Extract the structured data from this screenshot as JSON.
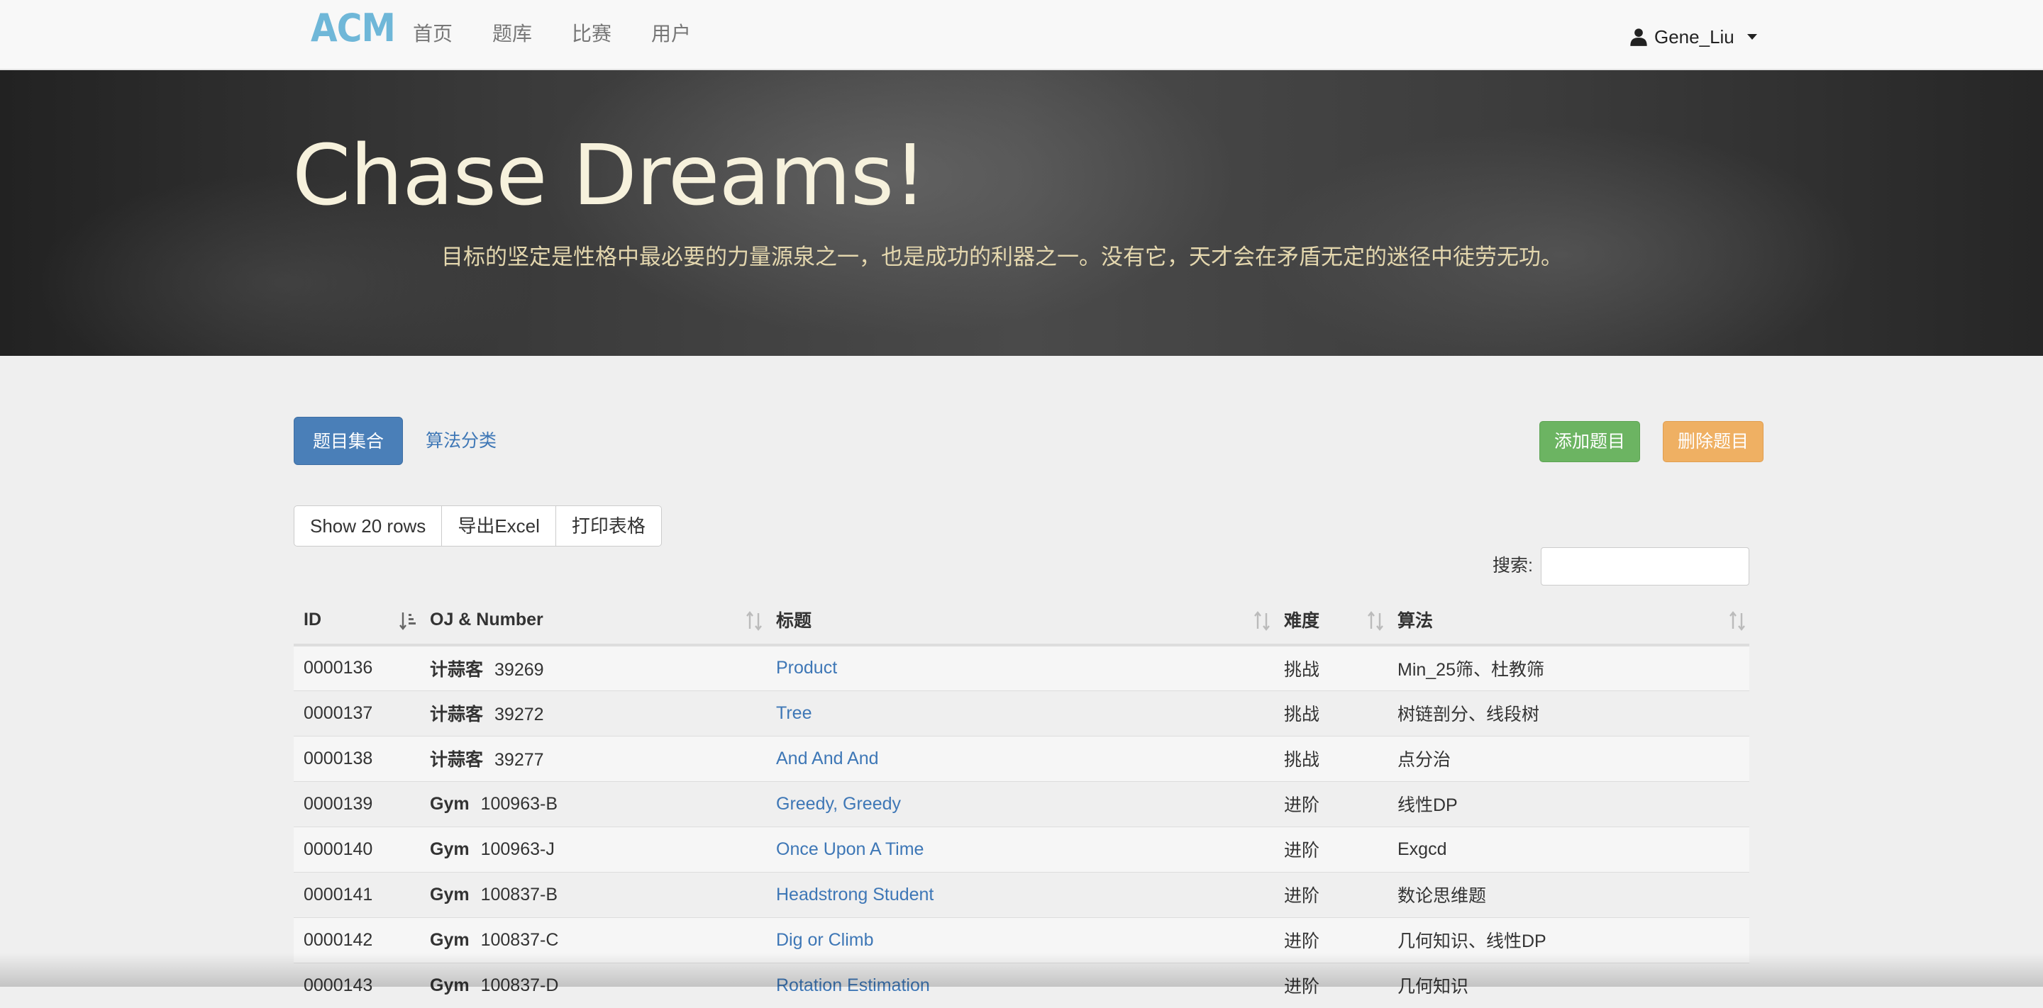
{
  "navbar": {
    "brand": "ACM",
    "links": [
      {
        "label": "首页"
      },
      {
        "label": "题库"
      },
      {
        "label": "比赛"
      },
      {
        "label": "用户"
      }
    ],
    "user": "Gene_Liu"
  },
  "hero": {
    "title": "Chase Dreams!",
    "subtitle": "目标的坚定是性格中最必要的力量源泉之一，也是成功的利器之一。没有它，天才会在矛盾无定的迷径中徒劳无功。"
  },
  "tabs": {
    "problem_set": "题目集合",
    "algorithm_category": "算法分类"
  },
  "actions": {
    "add": "添加题目",
    "delete": "删除题目"
  },
  "table_tools": {
    "show_rows": "Show 20 rows",
    "export_excel": "导出Excel",
    "print_table": "打印表格"
  },
  "search": {
    "label": "搜索:",
    "value": "",
    "placeholder": ""
  },
  "table": {
    "columns": [
      "ID",
      "OJ & Number",
      "标题",
      "难度",
      "算法"
    ],
    "rows": [
      {
        "id": "0000136",
        "oj": "计蒜客",
        "number": "39269",
        "title": "Product",
        "difficulty": "挑战",
        "algorithm": "Min_25筛、杜教筛"
      },
      {
        "id": "0000137",
        "oj": "计蒜客",
        "number": "39272",
        "title": "Tree",
        "difficulty": "挑战",
        "algorithm": "树链剖分、线段树"
      },
      {
        "id": "0000138",
        "oj": "计蒜客",
        "number": "39277",
        "title": "And And And",
        "difficulty": "挑战",
        "algorithm": "点分治"
      },
      {
        "id": "0000139",
        "oj": "Gym",
        "number": "100963-B",
        "title": "Greedy, Greedy",
        "difficulty": "进阶",
        "algorithm": "线性DP"
      },
      {
        "id": "0000140",
        "oj": "Gym",
        "number": "100963-J",
        "title": "Once Upon A Time",
        "difficulty": "进阶",
        "algorithm": "Exgcd"
      },
      {
        "id": "0000141",
        "oj": "Gym",
        "number": "100837-B",
        "title": "Headstrong Student",
        "difficulty": "进阶",
        "algorithm": "数论思维题"
      },
      {
        "id": "0000142",
        "oj": "Gym",
        "number": "100837-C",
        "title": "Dig or Climb",
        "difficulty": "进阶",
        "algorithm": "几何知识、线性DP"
      },
      {
        "id": "0000143",
        "oj": "Gym",
        "number": "100837-D",
        "title": "Rotation Estimation",
        "difficulty": "进阶",
        "algorithm": "几何知识"
      }
    ]
  },
  "colors": {
    "brand": "#6fb7d8",
    "primary": "#4a7fb8",
    "link": "#3e77b6",
    "success": "#6cb462",
    "warning": "#efb063",
    "hero_title": "#f6f1dc",
    "hero_subtitle": "#e4d7ae"
  }
}
